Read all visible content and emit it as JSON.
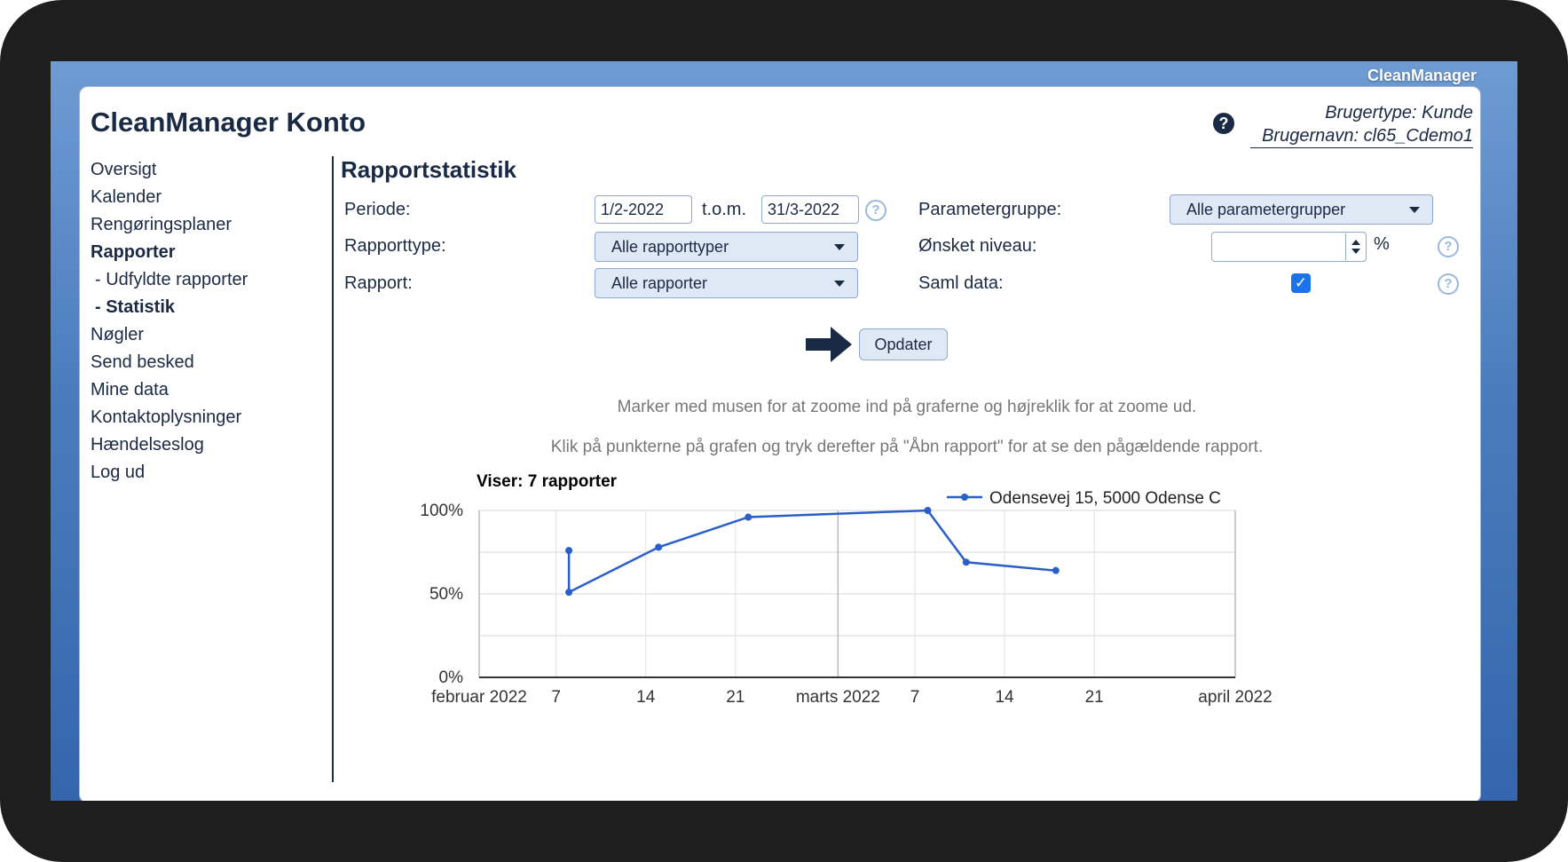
{
  "brand": "CleanManager",
  "app": {
    "title": "CleanManager Konto",
    "help_icon": "question-circle-icon",
    "user_type": "Brugertype: Kunde",
    "user_name": "Brugernavn: cl65_Cdemo1"
  },
  "nav": [
    {
      "label": "Oversigt"
    },
    {
      "label": "Kalender"
    },
    {
      "label": "Rengøringsplaner"
    },
    {
      "label": "Rapporter"
    },
    {
      "label": "- Udfyldte rapporter"
    },
    {
      "label": "- Statistik"
    },
    {
      "label": "Nøgler"
    },
    {
      "label": "Send besked"
    },
    {
      "label": "Mine data"
    },
    {
      "label": "Kontaktoplysninger"
    },
    {
      "label": "Hændelseslog"
    },
    {
      "label": "Log ud"
    }
  ],
  "page": {
    "title": "Rapportstatistik"
  },
  "form": {
    "periode_label": "Periode:",
    "from_value": "1/2-2022",
    "tom_label": "t.o.m.",
    "to_value": "31/3-2022",
    "rapporttype_label": "Rapporttype:",
    "rapporttype_value": "Alle rapporttyper",
    "rapport_label": "Rapport:",
    "rapport_value": "Alle rapporter",
    "parametergruppe_label": "Parametergruppe:",
    "parametergruppe_value": "Alle parametergrupper",
    "niveau_label": "Ønsket niveau:",
    "niveau_value": "",
    "percent": "%",
    "saml_label": "Saml data:",
    "saml_checked": true,
    "update_button": "Opdater",
    "help_mark": "?"
  },
  "hints": {
    "zoom": "Marker med musen for at zoome ind på graferne og højreklik for at zoome ud.",
    "click": "Klik på punkterne på grafen og tryk derefter på \"Åbn rapport\" for at se den pågældende rapport."
  },
  "chart_header": "Viser: 7 rapporter",
  "chart_data": {
    "type": "line",
    "series": [
      {
        "name": "Odensevej 15, 5000 Odense C",
        "color": "#2a5fc9",
        "points": [
          {
            "x": "2022-02-08",
            "y": 76
          },
          {
            "x": "2022-02-08",
            "y": 51
          },
          {
            "x": "2022-02-15",
            "y": 78
          },
          {
            "x": "2022-02-22",
            "y": 96
          },
          {
            "x": "2022-03-08",
            "y": 100
          },
          {
            "x": "2022-03-11",
            "y": 69
          },
          {
            "x": "2022-03-18",
            "y": 64
          }
        ]
      }
    ],
    "x_ticks": [
      "februar 2022",
      "7",
      "14",
      "21",
      "marts 2022",
      "7",
      "14",
      "21",
      "april 2022"
    ],
    "y_ticks": [
      "100%",
      "50%",
      "0%"
    ],
    "ylim": [
      0,
      100
    ],
    "xlim": [
      "2022-02-01",
      "2022-04-01"
    ],
    "grid": true,
    "legend": "top-right"
  }
}
